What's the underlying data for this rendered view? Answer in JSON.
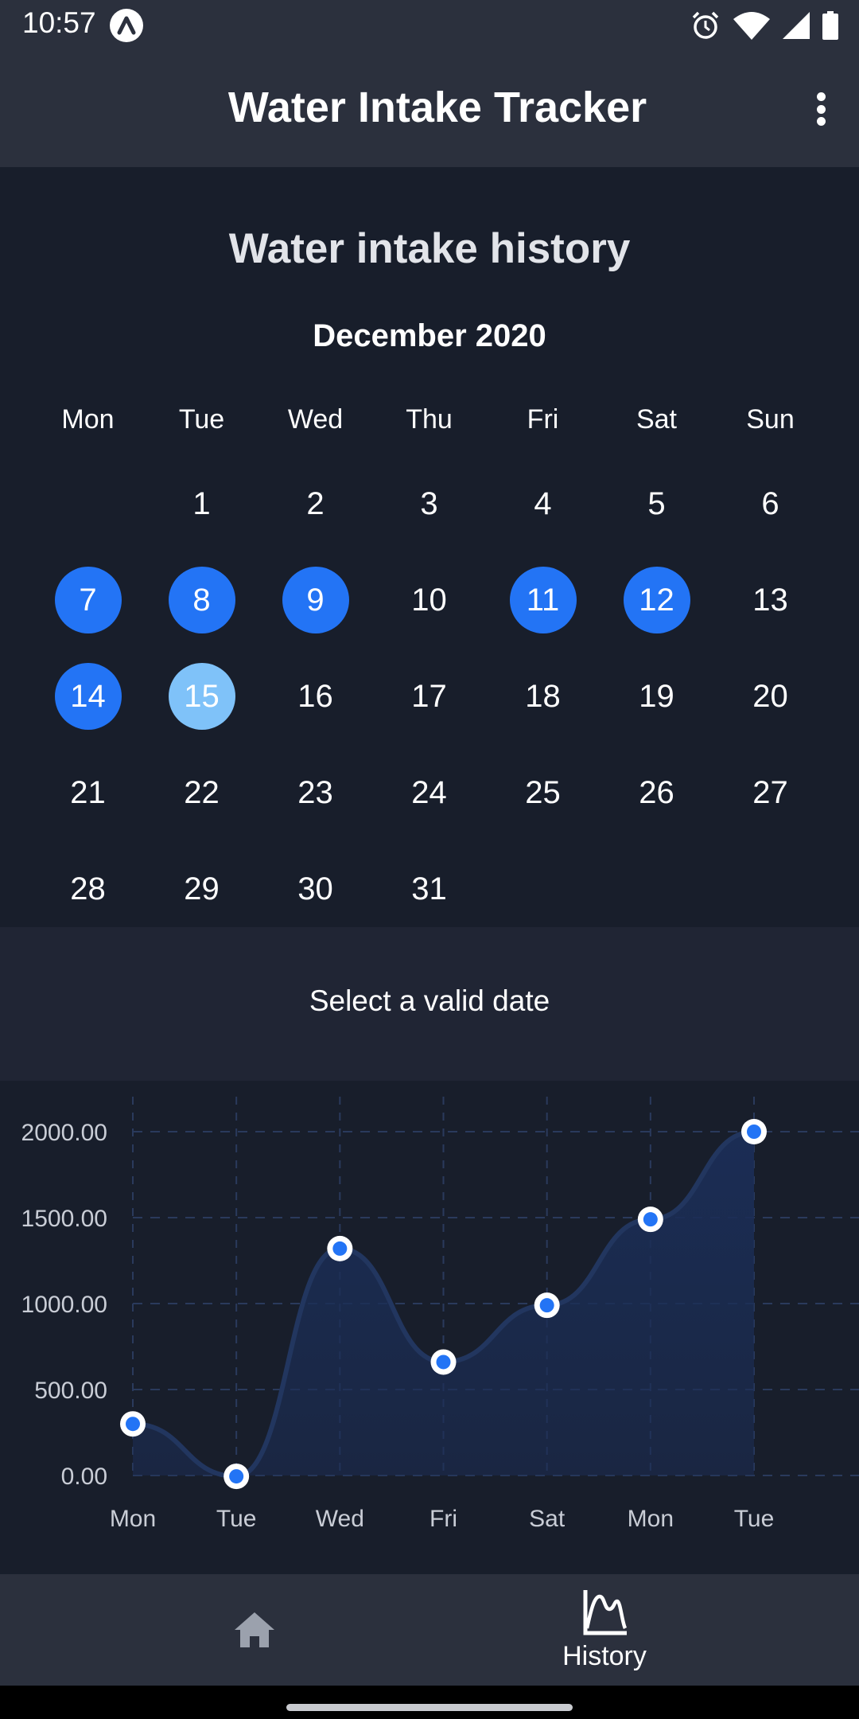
{
  "status_bar": {
    "time": "10:57",
    "icons": [
      "app-notification-icon",
      "alarm-icon",
      "wifi-icon",
      "signal-icon",
      "battery-icon"
    ]
  },
  "app_bar": {
    "title": "Water Intake Tracker",
    "menu_icon": "more-vert-icon"
  },
  "calendar": {
    "heading": "Water intake history",
    "month": "December 2020",
    "weekdays": [
      "Mon",
      "Tue",
      "Wed",
      "Thu",
      "Fri",
      "Sat",
      "Sun"
    ],
    "days": [
      {
        "label": ""
      },
      {
        "label": "1"
      },
      {
        "label": "2"
      },
      {
        "label": "3"
      },
      {
        "label": "4"
      },
      {
        "label": "5"
      },
      {
        "label": "6"
      },
      {
        "label": "7",
        "state": "logged"
      },
      {
        "label": "8",
        "state": "logged"
      },
      {
        "label": "9",
        "state": "logged"
      },
      {
        "label": "10"
      },
      {
        "label": "11",
        "state": "logged"
      },
      {
        "label": "12",
        "state": "logged"
      },
      {
        "label": "13"
      },
      {
        "label": "14",
        "state": "logged"
      },
      {
        "label": "15",
        "state": "today"
      },
      {
        "label": "16"
      },
      {
        "label": "17"
      },
      {
        "label": "18"
      },
      {
        "label": "19"
      },
      {
        "label": "20"
      },
      {
        "label": "21"
      },
      {
        "label": "22"
      },
      {
        "label": "23"
      },
      {
        "label": "24"
      },
      {
        "label": "25"
      },
      {
        "label": "26"
      },
      {
        "label": "27"
      },
      {
        "label": "28"
      },
      {
        "label": "29"
      },
      {
        "label": "30"
      },
      {
        "label": "31"
      }
    ],
    "colors": {
      "logged": "#2374f5",
      "today": "#7fc2f9"
    }
  },
  "message": "Select a valid date",
  "chart_data": {
    "type": "area",
    "categories": [
      "Mon",
      "Tue",
      "Wed",
      "Fri",
      "Sat",
      "Mon",
      "Tue"
    ],
    "series": [
      {
        "values": [
          300,
          -5,
          1320,
          660,
          990,
          1490,
          2000
        ]
      }
    ],
    "yticks": [
      "0.00",
      "500.00",
      "1000.00",
      "1500.00",
      "2000.00"
    ],
    "ylim": [
      0,
      2000
    ],
    "grid": true,
    "colors": {
      "line": "#2374f5",
      "fill": "#1b2d55",
      "grid": "#2a3a5c",
      "text": "#c9cdd6"
    }
  },
  "bottom_nav": {
    "home_icon": "home-icon",
    "history_icon": "chart-icon",
    "history_label": "History"
  }
}
